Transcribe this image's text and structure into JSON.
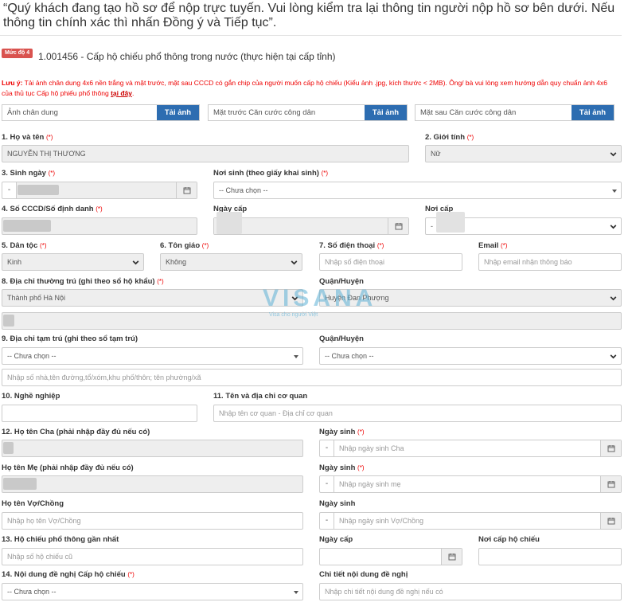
{
  "intro": "“Quý khách đang tạo hồ sơ để nộp trực tuyến. Vui lòng kiểm tra lại thông tin người nộp hồ sơ bên dưới. Nếu thông tin chính xác thì nhấn Đồng ý và Tiếp tục”.",
  "procedure": {
    "badge": "Mức độ 4",
    "title": "1.001456 - Cấp hộ chiếu phổ thông trong nước (thực hiện tại cấp tỉnh)"
  },
  "note": {
    "prefix": "Lưu ý:",
    "body": " Tải ảnh chân dung 4x6 nền trắng và mặt trước, mặt sau CCCD có gắn chip của người muốn cấp hộ chiếu (Kiểu ảnh .jpg, kích thước < 2MB). Ông/ bà vui lòng xem hướng dẫn quy chuẩn ảnh 4x6 của thủ tục Cấp hộ phiếu phổ thông ",
    "link": "tại đây",
    "suffix": "."
  },
  "uploads": [
    {
      "placeholder": "Ảnh chân dung",
      "button": "Tải ảnh"
    },
    {
      "placeholder": "Mặt trước Căn cước công dân",
      "button": "Tải ảnh"
    },
    {
      "placeholder": "Mặt sau Căn cước công dân",
      "button": "Tải ảnh"
    }
  ],
  "required_mark": "(*)",
  "form": {
    "full_name": {
      "label": "1. Họ và tên",
      "value": "NGUYỄN THỊ THƯƠNG"
    },
    "gender": {
      "label": "2. Giới tính",
      "value": "Nữ"
    },
    "dob": {
      "label": "3. Sinh ngày",
      "dash": "-"
    },
    "birthplace": {
      "label": "Nơi sinh (theo giấy khai sinh)",
      "value": "-- Chưa chọn --"
    },
    "id_number": {
      "label": "4. Số CCCD/Số định danh"
    },
    "issue_date": {
      "label": "Ngày cấp"
    },
    "issue_place": {
      "label": "Nơi cấp",
      "value": "-"
    },
    "ethnicity": {
      "label": "5. Dân tộc",
      "value": "Kinh"
    },
    "religion": {
      "label": "6. Tôn giáo",
      "value": "Không"
    },
    "phone": {
      "label": "7. Số điện thoại",
      "placeholder": "Nhập số điện thoại"
    },
    "email": {
      "label": "Email",
      "placeholder": "Nhập email nhận thông báo"
    },
    "permanent_address": {
      "label": "8. Địa chỉ thường trú (ghi theo sổ hộ khẩu)",
      "province": "Thành phố Hà Nội"
    },
    "permanent_district": {
      "label": "Quận/Huyện",
      "value": "Huyện Đan Phượng"
    },
    "temp_address": {
      "label": "9. Địa chỉ tạm trú (ghi theo sổ tạm trú)",
      "province": "-- Chưa chọn --",
      "street_placeholder": "Nhập số nhà,tên đường,tổ/xóm,khu phố/thôn; tên phường/xã"
    },
    "temp_district": {
      "label": "Quận/Huyện",
      "value": "-- Chưa chọn --"
    },
    "occupation": {
      "label": "10. Nghề nghiệp"
    },
    "workplace": {
      "label": "11. Tên và địa chỉ cơ quan",
      "placeholder": "Nhập tên cơ quan - Địa chỉ cơ quan"
    },
    "father": {
      "label": "12. Họ tên Cha (phải nhập đầy đủ nếu có)",
      "dob_label": "Ngày sinh",
      "dob_placeholder": "Nhập ngày sinh Cha"
    },
    "mother": {
      "label": "Họ tên Mẹ (phải nhập đầy đủ nếu có)",
      "dob_label": "Ngày sinh",
      "dob_placeholder": "Nhập ngày sinh mẹ"
    },
    "spouse": {
      "label": "Họ tên Vợ/Chồng",
      "placeholder": "Nhập họ tên Vợ/Chồng",
      "dob_label": "Ngày sinh",
      "dob_placeholder": "Nhập ngày sinh Vợ/Chồng"
    },
    "last_passport": {
      "label": "13. Hộ chiếu phổ thông gần nhất",
      "placeholder": "Nhập số hộ chiếu cũ",
      "date_label": "Ngày cấp",
      "place_label": "Nơi cấp hộ chiếu"
    },
    "request": {
      "label": "14. Nội dung đề nghị Cấp hộ chiếu",
      "value": "-- Chưa chọn --"
    },
    "request_detail": {
      "label": "Chi tiết nội dung đề nghị",
      "placeholder": "Nhập chi tiết nội dung đề nghị nếu có"
    }
  },
  "watermark": {
    "brand": "VISANA",
    "tagline": "Visa cho người Việt"
  }
}
